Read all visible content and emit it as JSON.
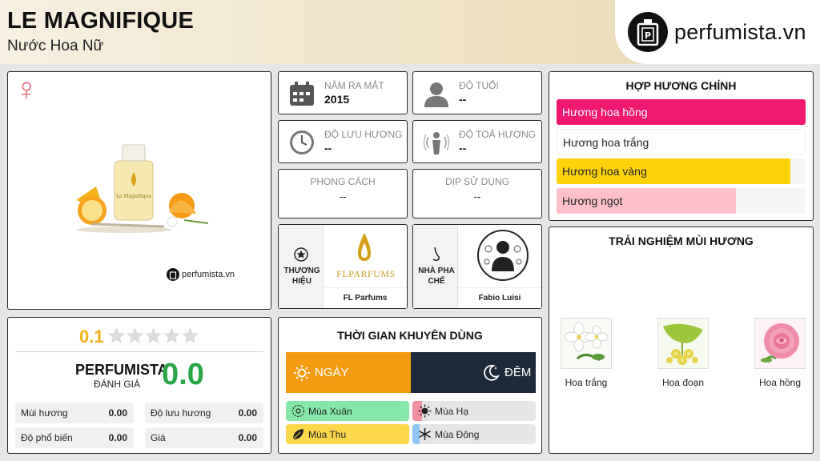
{
  "header": {
    "title": "LE MAGNIFIQUE",
    "subtitle": "Nước Hoa Nữ",
    "logo_text": "perfumista.vn"
  },
  "product": {
    "gender_symbol": "♀",
    "watermark": "perfumista.vn"
  },
  "info": {
    "launch": {
      "label": "NĂM RA MẮT",
      "value": "2015"
    },
    "age": {
      "label": "ĐỘ TUỔI",
      "value": "--"
    },
    "longevity": {
      "label": "ĐỘ LƯU HƯƠNG",
      "value": "--"
    },
    "sillage": {
      "label": "ĐỘ TOẢ HƯƠNG",
      "value": "--"
    },
    "style": {
      "label": "PHONG CÁCH",
      "value": "--"
    },
    "occasion": {
      "label": "DỊP SỬ DỤNG",
      "value": "--"
    }
  },
  "brand": {
    "label": "THƯƠNG HIỆU",
    "logo_text": "FLPARFUMS",
    "name": "FL Parfums"
  },
  "perfumer": {
    "label": "NHÀ PHA CHẾ",
    "name": "Fabio Luisi"
  },
  "accords": {
    "title": "HỢP HƯƠNG CHÍNH",
    "items": [
      {
        "label": "Hương hoa hồng",
        "value": 100,
        "color": "#f0186f",
        "text_color": "#ffffff"
      },
      {
        "label": "Hương hoa trắng",
        "value": 100,
        "color": "#ffffff",
        "text_color": "#222222"
      },
      {
        "label": "Hương hoa vàng",
        "value": 94,
        "color": "#fdd20a",
        "text_color": "#222222"
      },
      {
        "label": "Hương ngọt",
        "value": 72,
        "color": "#ffc0cb",
        "text_color": "#222222"
      }
    ]
  },
  "experience": {
    "title": "TRẢI NGHIỆM MÙI HƯƠNG",
    "notes": [
      {
        "label": "Hoa trắng"
      },
      {
        "label": "Hoa đoạn"
      },
      {
        "label": "Hoa hồng"
      }
    ]
  },
  "rating": {
    "score": "0.1",
    "stars": 0,
    "brand": "PERFUMISTA",
    "label": "ĐÁNH GIÁ",
    "value": "0.0",
    "stats": [
      {
        "key": "Mùi hương",
        "value": "0.00"
      },
      {
        "key": "Độ lưu hương",
        "value": "0.00"
      },
      {
        "key": "Độ phổ biến",
        "value": "0.00"
      },
      {
        "key": "Giá",
        "value": "0.00"
      }
    ]
  },
  "time": {
    "title": "THỜI GIAN KHUYÊN DÙNG",
    "day": "NGÀY",
    "night": "ĐÊM",
    "day_color": "#f39c12",
    "night_color": "#1e2a3a",
    "seasons": [
      {
        "label": "Mùa Xuân",
        "value": 100,
        "color": "#86e8a8"
      },
      {
        "label": "Mùa Hạ",
        "value": 8,
        "color": "#f48fa0"
      },
      {
        "label": "Mùa Thu",
        "value": 100,
        "color": "#fbd74a"
      },
      {
        "label": "Mùa Đông",
        "value": 6,
        "color": "#8ec5f5"
      }
    ]
  }
}
